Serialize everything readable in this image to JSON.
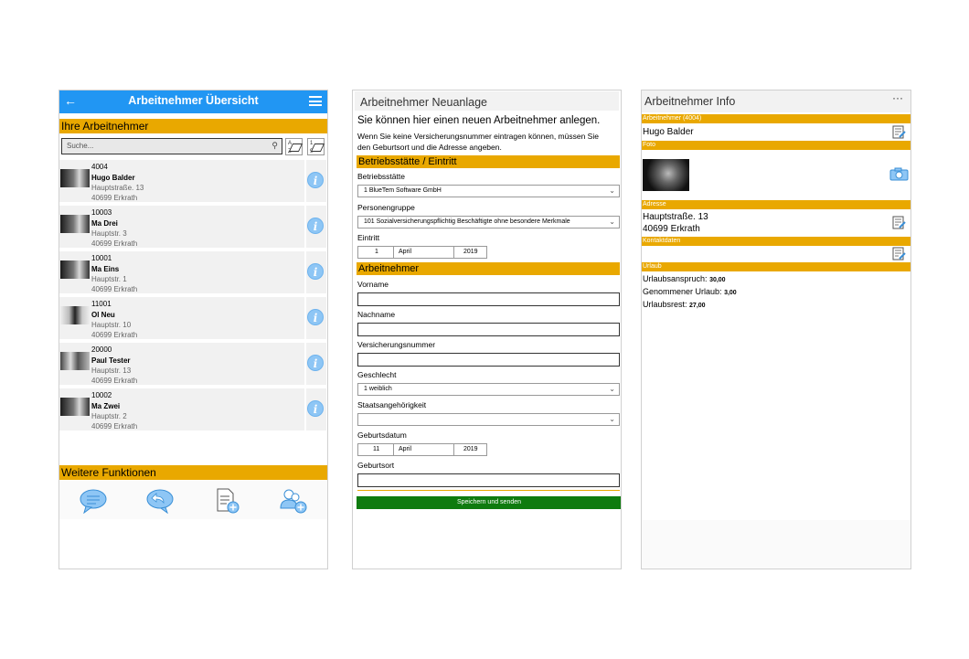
{
  "overview": {
    "title": "Arbeitnehmer Übersicht",
    "section_title": "Ihre Arbeitnehmer",
    "search_placeholder": "Suche...",
    "sort_alpha": {
      "top": "A",
      "bottom": "Z"
    },
    "sort_num": {
      "top": "1",
      "bottom": "9"
    },
    "employees": [
      {
        "id": "4004",
        "name": "Hugo Balder",
        "street": "Hauptstraße. 13",
        "city": "40699 Erkrath"
      },
      {
        "id": "10003",
        "name": "Ma Drei",
        "street": "Hauptstr. 3",
        "city": "40699 Erkrath"
      },
      {
        "id": "10001",
        "name": "Ma Eins",
        "street": "Hauptstr. 1",
        "city": "40699 Erkrath"
      },
      {
        "id": "11001",
        "name": "Ol Neu",
        "street": "Hauptstr. 10",
        "city": "40699 Erkrath"
      },
      {
        "id": "20000",
        "name": "Paul Tester",
        "street": "Hauptstr. 13",
        "city": "40699 Erkrath"
      },
      {
        "id": "10002",
        "name": "Ma Zwei",
        "street": "Hauptstr.  2",
        "city": "40699 Erkrath"
      }
    ],
    "info_glyph": "i",
    "more_functions": "Weitere Funktionen",
    "function_icons": [
      "chat-icon",
      "reply-icon",
      "new-document-icon",
      "add-users-icon"
    ]
  },
  "new_employee": {
    "title": "Arbeitnehmer Neuanlage",
    "intro": "Sie können hier einen neuen Arbeitnehmer anlegen.",
    "hint_line1": "Wenn Sie keine Versicherungsnummer eintragen können, müssen Sie",
    "hint_line2": "den Geburtsort und die Adresse angeben.",
    "section1": "Betriebsstätte / Eintritt",
    "betriebsstaette_label": "Betriebsstätte",
    "betriebsstaette_value": "1 BlueTem Software GmbH",
    "personengruppe_label": "Personengruppe",
    "personengruppe_value": "101 Sozialversicherungspflichtig Beschäftigte ohne besondere Merkmale",
    "eintritt_label": "Eintritt",
    "eintritt": {
      "day": "1",
      "month": "April",
      "year": "2019"
    },
    "section2": "Arbeitnehmer",
    "vorname_label": "Vorname",
    "nachname_label": "Nachname",
    "versicherung_label": "Versicherungsnummer",
    "geschlecht_label": "Geschlecht",
    "geschlecht_value": "1 weiblich",
    "staat_label": "Staatsangehörigkeit",
    "staat_value": "",
    "geburtsdatum_label": "Geburtsdatum",
    "geburtsdatum": {
      "day": "11",
      "month": "April",
      "year": "2019"
    },
    "geburtsort_label": "Geburtsort",
    "save_label": "Speichern und senden",
    "save_color": "#0f7b0f"
  },
  "info": {
    "title": "Arbeitnehmer Info",
    "menu_glyph": "···",
    "employee_header": "Arbeitnehmer (4004)",
    "employee_name": "Hugo Balder",
    "foto_header": "Foto",
    "adresse_header": "Adresse",
    "street": "Hauptstraße. 13",
    "city": "40699 Erkrath",
    "kontakt_header": "Kontaktdaten",
    "urlaub_header": "Urlaub",
    "urlaubsanspruch_label": "Urlaubsanspruch:",
    "urlaubsanspruch_value": "30,00",
    "genommen_label": "Genommener Urlaub:",
    "genommen_value": "3,00",
    "rest_label": "Urlaubsrest:",
    "rest_value": "27,00"
  },
  "colors": {
    "accent_blue": "#2196f3",
    "section_yellow": "#e9a800",
    "info_blue": "#8ec6f5"
  }
}
